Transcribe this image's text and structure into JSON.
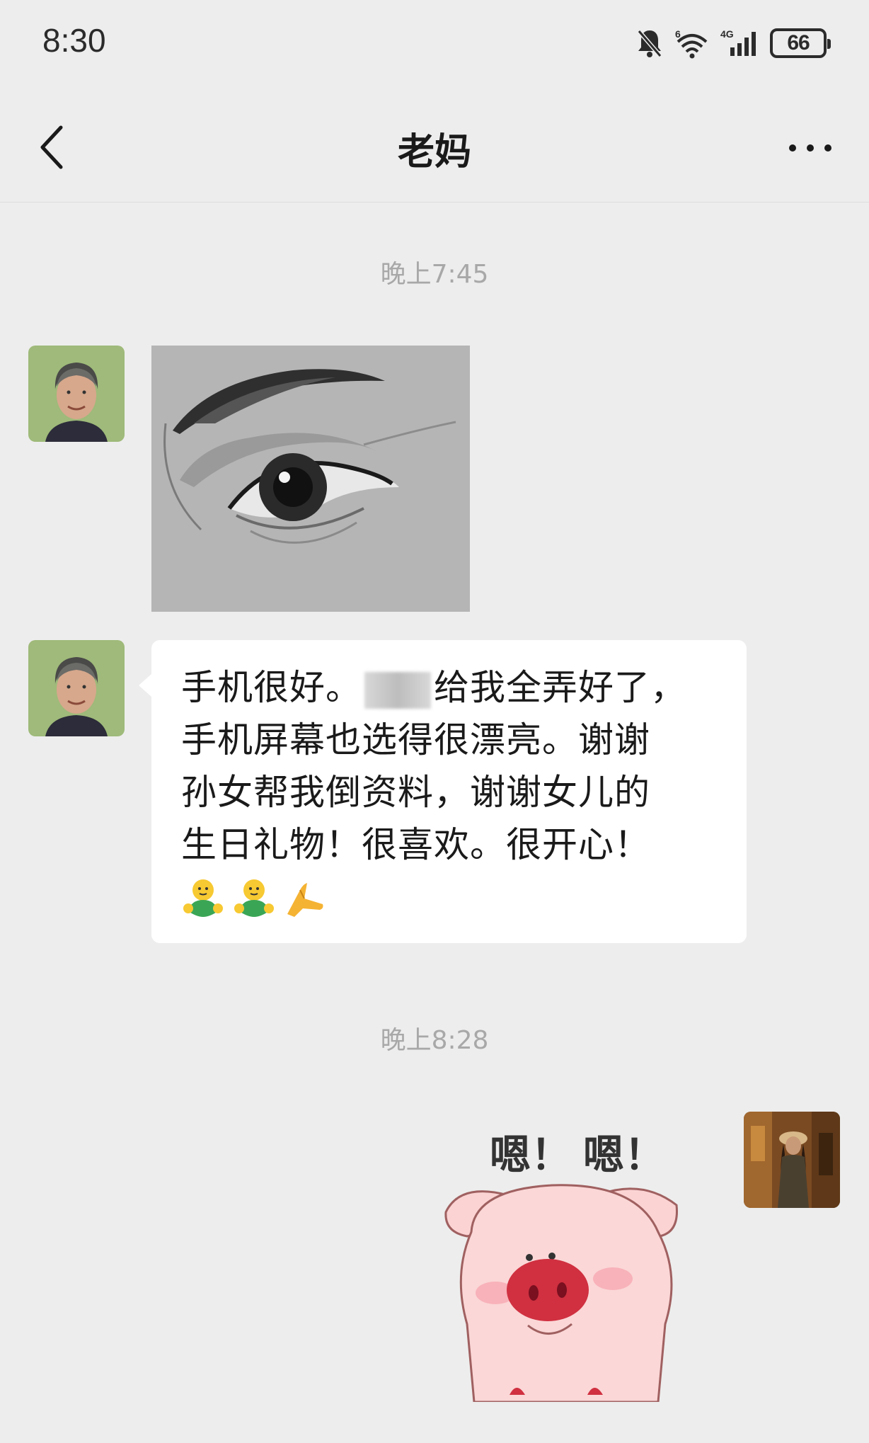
{
  "status_bar": {
    "time": "8:30",
    "battery_level": "66",
    "icons": [
      "bell-off-icon",
      "wifi-6-icon",
      "signal-4g-icon",
      "battery-icon"
    ]
  },
  "nav": {
    "title": "老妈",
    "back_icon": "chevron-left-icon",
    "more_icon": "more-dots-icon"
  },
  "messages": [
    {
      "type": "timestamp",
      "text": "晚上7:45"
    },
    {
      "type": "image",
      "from": "mom",
      "description_icon": "eye-sketch-image"
    },
    {
      "type": "text",
      "from": "mom",
      "lines": [
        "手机很好。",
        "给我全弄好了，",
        "手机屏幕也选得很漂亮。谢谢",
        "孙女帮我倒资料，谢谢女儿的",
        "生日礼物！很喜欢。很开心！"
      ],
      "emojis": [
        "hug-emoji",
        "hug-emoji",
        "pray-emoji"
      ]
    },
    {
      "type": "timestamp",
      "text": "晚上8:28"
    },
    {
      "type": "sticker",
      "from": "me",
      "sticker_text": [
        "嗯！",
        "嗯！"
      ],
      "sticker_icon": "pig-sticker"
    }
  ],
  "colors": {
    "background": "#ededed",
    "bubble_incoming": "#ffffff",
    "timestamp_text": "#a8a8a8",
    "avatar_mom_bg": "#9fba7a"
  }
}
